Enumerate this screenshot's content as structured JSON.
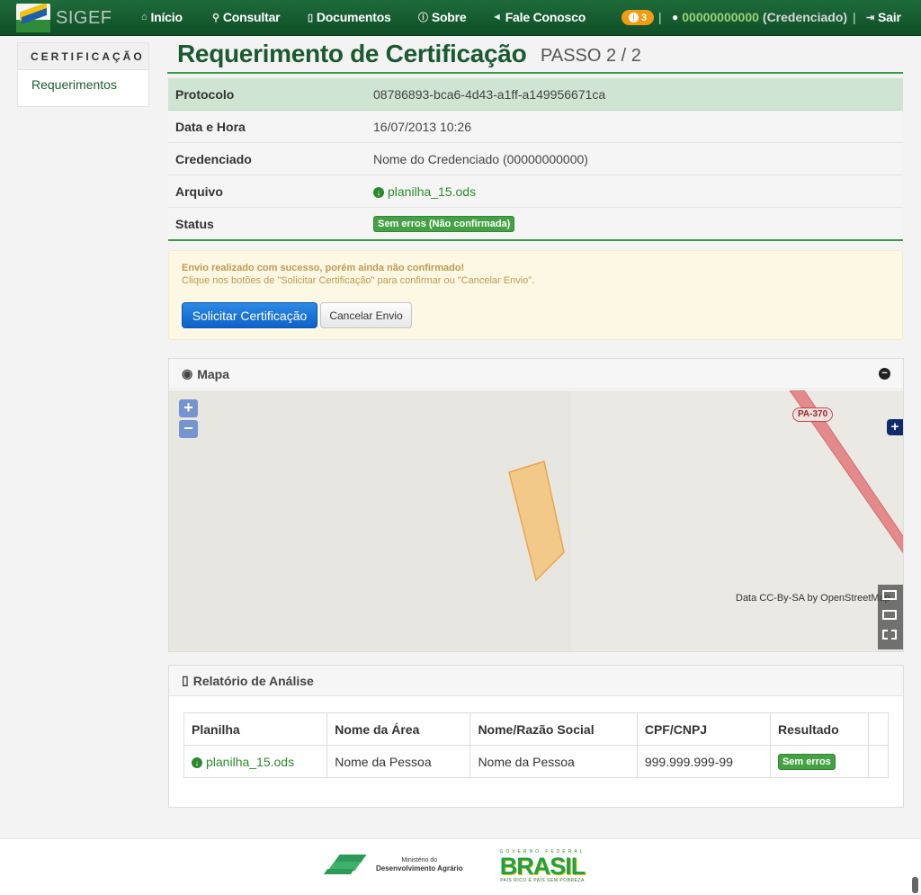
{
  "nav": {
    "brand": "SIGEF",
    "items": [
      {
        "label": "Início",
        "icon": "home-icon"
      },
      {
        "label": "Consultar",
        "icon": "search-icon"
      },
      {
        "label": "Documentos",
        "icon": "document-icon"
      },
      {
        "label": "Sobre",
        "icon": "info-icon"
      },
      {
        "label": "Fale Conosco",
        "icon": "megaphone-icon"
      }
    ],
    "notification_count": "3",
    "separator": "|",
    "user_id": "00000000000",
    "user_role": "(Credenciado)",
    "logout": "Sair"
  },
  "sidebar": {
    "header": "CERTIFICAÇÃO",
    "items": [
      {
        "label": "Requerimentos"
      }
    ]
  },
  "page": {
    "title": "Requerimento de Certificação",
    "step": "PASSO 2 / 2"
  },
  "details": {
    "protocolo_label": "Protocolo",
    "protocolo_value": "08786893-bca6-4d43-a1ff-a149956671ca",
    "data_label": "Data e Hora",
    "data_value": "16/07/2013 10:26",
    "credenciado_label": "Credenciado",
    "credenciado_value": "Nome do Credenciado (00000000000)",
    "arquivo_label": "Arquivo",
    "arquivo_value": "planilha_15.ods",
    "status_label": "Status",
    "status_value": "Sem erros (Não confirmada)"
  },
  "alert": {
    "title": "Envio realizado com sucesso, porém ainda não confirmado!",
    "message": "Clique nos botões de \"Solicitar Certificação\" para confirmar ou \"Cancelar Envio\".",
    "primary_button": "Solicitar Certificação",
    "secondary_button": "Cancelar Envio"
  },
  "map": {
    "heading": "Mapa",
    "road_label": "PA-370",
    "zoom_in": "+",
    "zoom_out": "−",
    "attribution_prefix": "Data CC-By-SA by ",
    "attribution_source": "OpenStreetMap"
  },
  "report": {
    "heading": "Relatório de Análise",
    "columns": [
      "Planilha",
      "Nome da Área",
      "Nome/Razão Social",
      "CPF/CNPJ",
      "Resultado"
    ],
    "rows": [
      {
        "planilha": "planilha_15.ods",
        "area": "Nome da Pessoa",
        "razao": "Nome da Pessoa",
        "cpf": "999.999.999-99",
        "resultado": "Sem erros"
      }
    ]
  },
  "footer": {
    "mda_line1": "Ministério do",
    "mda_line2": "Desenvolvimento Agrário",
    "brasil_top": "GOVERNO FEDERAL",
    "brasil_word": "BRASIL",
    "brasil_slogan": "PAÍS RICO É PAÍS SEM POBREZA"
  },
  "colors": {
    "nav_green": "#1e6b3a",
    "title_green": "#1b5a31",
    "success_green": "#46a146",
    "primary_blue": "#0d62c9",
    "alert_bg": "#fcf8e3",
    "parcel_fill": "#f3c98a",
    "road": "#e58a8a"
  }
}
